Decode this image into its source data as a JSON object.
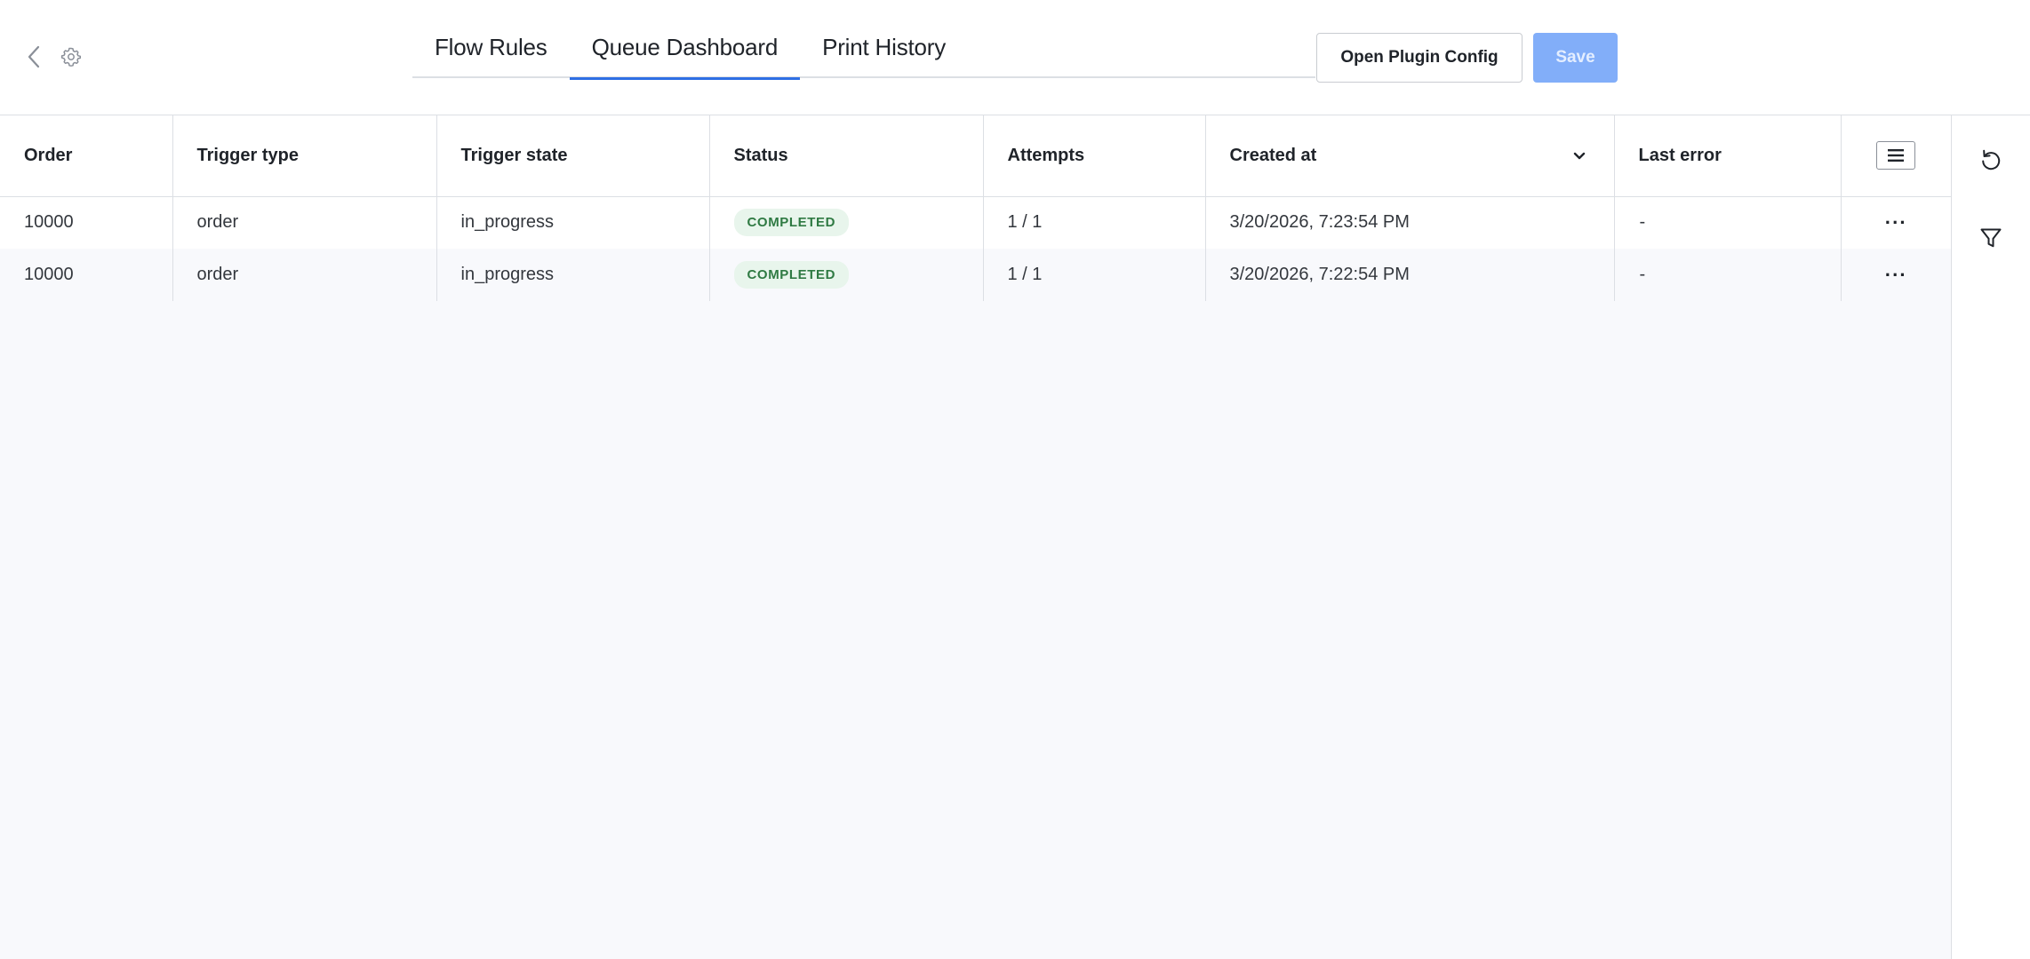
{
  "header": {
    "icons": {
      "back": "chevron-left-icon",
      "settings": "gear-icon"
    },
    "tabs": [
      {
        "label": "Flow Rules",
        "active": false
      },
      {
        "label": "Queue Dashboard",
        "active": true
      },
      {
        "label": "Print History",
        "active": false
      }
    ],
    "open_plugin_config_label": "Open Plugin Config",
    "save_label": "Save"
  },
  "table": {
    "columns": [
      "Order",
      "Trigger type",
      "Trigger state",
      "Status",
      "Attempts",
      "Created at",
      "Last error"
    ],
    "sorted_column": "Created at",
    "sort_direction": "descending",
    "rows": [
      {
        "order": "10000",
        "trigger_type": "order",
        "trigger_state": "in_progress",
        "status": "COMPLETED",
        "attempts": "1 / 1",
        "created_at": "3/20/2026, 7:23:54 PM",
        "last_error": "-",
        "actions": "···"
      },
      {
        "order": "10000",
        "trigger_type": "order",
        "trigger_state": "in_progress",
        "status": "COMPLETED",
        "attempts": "1 / 1",
        "created_at": "3/20/2026, 7:22:54 PM",
        "last_error": "-",
        "actions": "···"
      }
    ]
  },
  "rail": {
    "icons": [
      "refresh-icon",
      "filter-icon"
    ]
  },
  "colors": {
    "accent": "#2f6fe4",
    "primary_button_disabled": "#82aef9",
    "status_completed_bg": "#e8f5ec",
    "status_completed_text": "#2f7a43",
    "table_area_bg": "#f8f9fc"
  }
}
